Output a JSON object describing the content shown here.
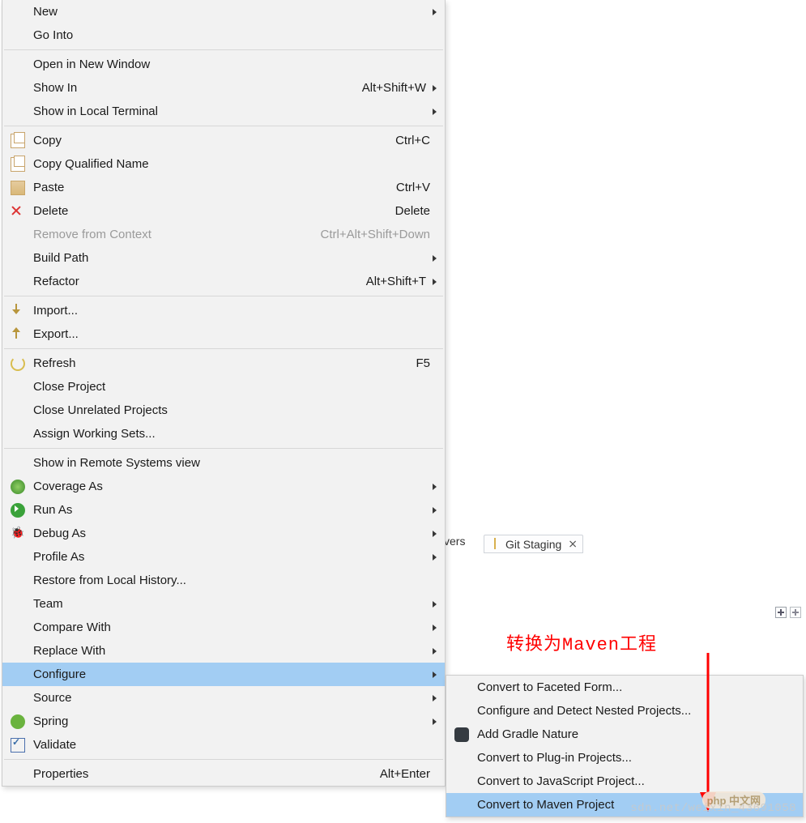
{
  "background": {
    "tab_servers_suffix": "vers",
    "git_staging_tab": "Git Staging",
    "watermark": "sdn.net/weixin_43691058",
    "php_logo": "php 中文网"
  },
  "menu": {
    "new": "New",
    "go_into": "Go Into",
    "open_new_window": "Open in New Window",
    "show_in": "Show In",
    "show_in_accel": "Alt+Shift+W",
    "show_local_terminal": "Show in Local Terminal",
    "copy": "Copy",
    "copy_accel": "Ctrl+C",
    "copy_qualified": "Copy Qualified Name",
    "paste": "Paste",
    "paste_accel": "Ctrl+V",
    "delete": "Delete",
    "delete_accel": "Delete",
    "remove_context": "Remove from Context",
    "remove_context_accel": "Ctrl+Alt+Shift+Down",
    "build_path": "Build Path",
    "refactor": "Refactor",
    "refactor_accel": "Alt+Shift+T",
    "import": "Import...",
    "export": "Export...",
    "refresh": "Refresh",
    "refresh_accel": "F5",
    "close_project": "Close Project",
    "close_unrelated": "Close Unrelated Projects",
    "assign_ws": "Assign Working Sets...",
    "show_remote": "Show in Remote Systems view",
    "coverage_as": "Coverage As",
    "run_as": "Run As",
    "debug_as": "Debug As",
    "profile_as": "Profile As",
    "restore_hist": "Restore from Local History...",
    "team": "Team",
    "compare_with": "Compare With",
    "replace_with": "Replace With",
    "configure": "Configure",
    "source": "Source",
    "spring": "Spring",
    "validate": "Validate",
    "properties": "Properties",
    "properties_accel": "Alt+Enter"
  },
  "submenu": {
    "faceted": "Convert to Faceted Form...",
    "nested": "Configure and Detect Nested Projects...",
    "gradle": "Add Gradle Nature",
    "plugin": "Convert to Plug-in Projects...",
    "js": "Convert to JavaScript Project...",
    "maven": "Convert to Maven Project"
  },
  "annotation": "转换为Maven工程"
}
